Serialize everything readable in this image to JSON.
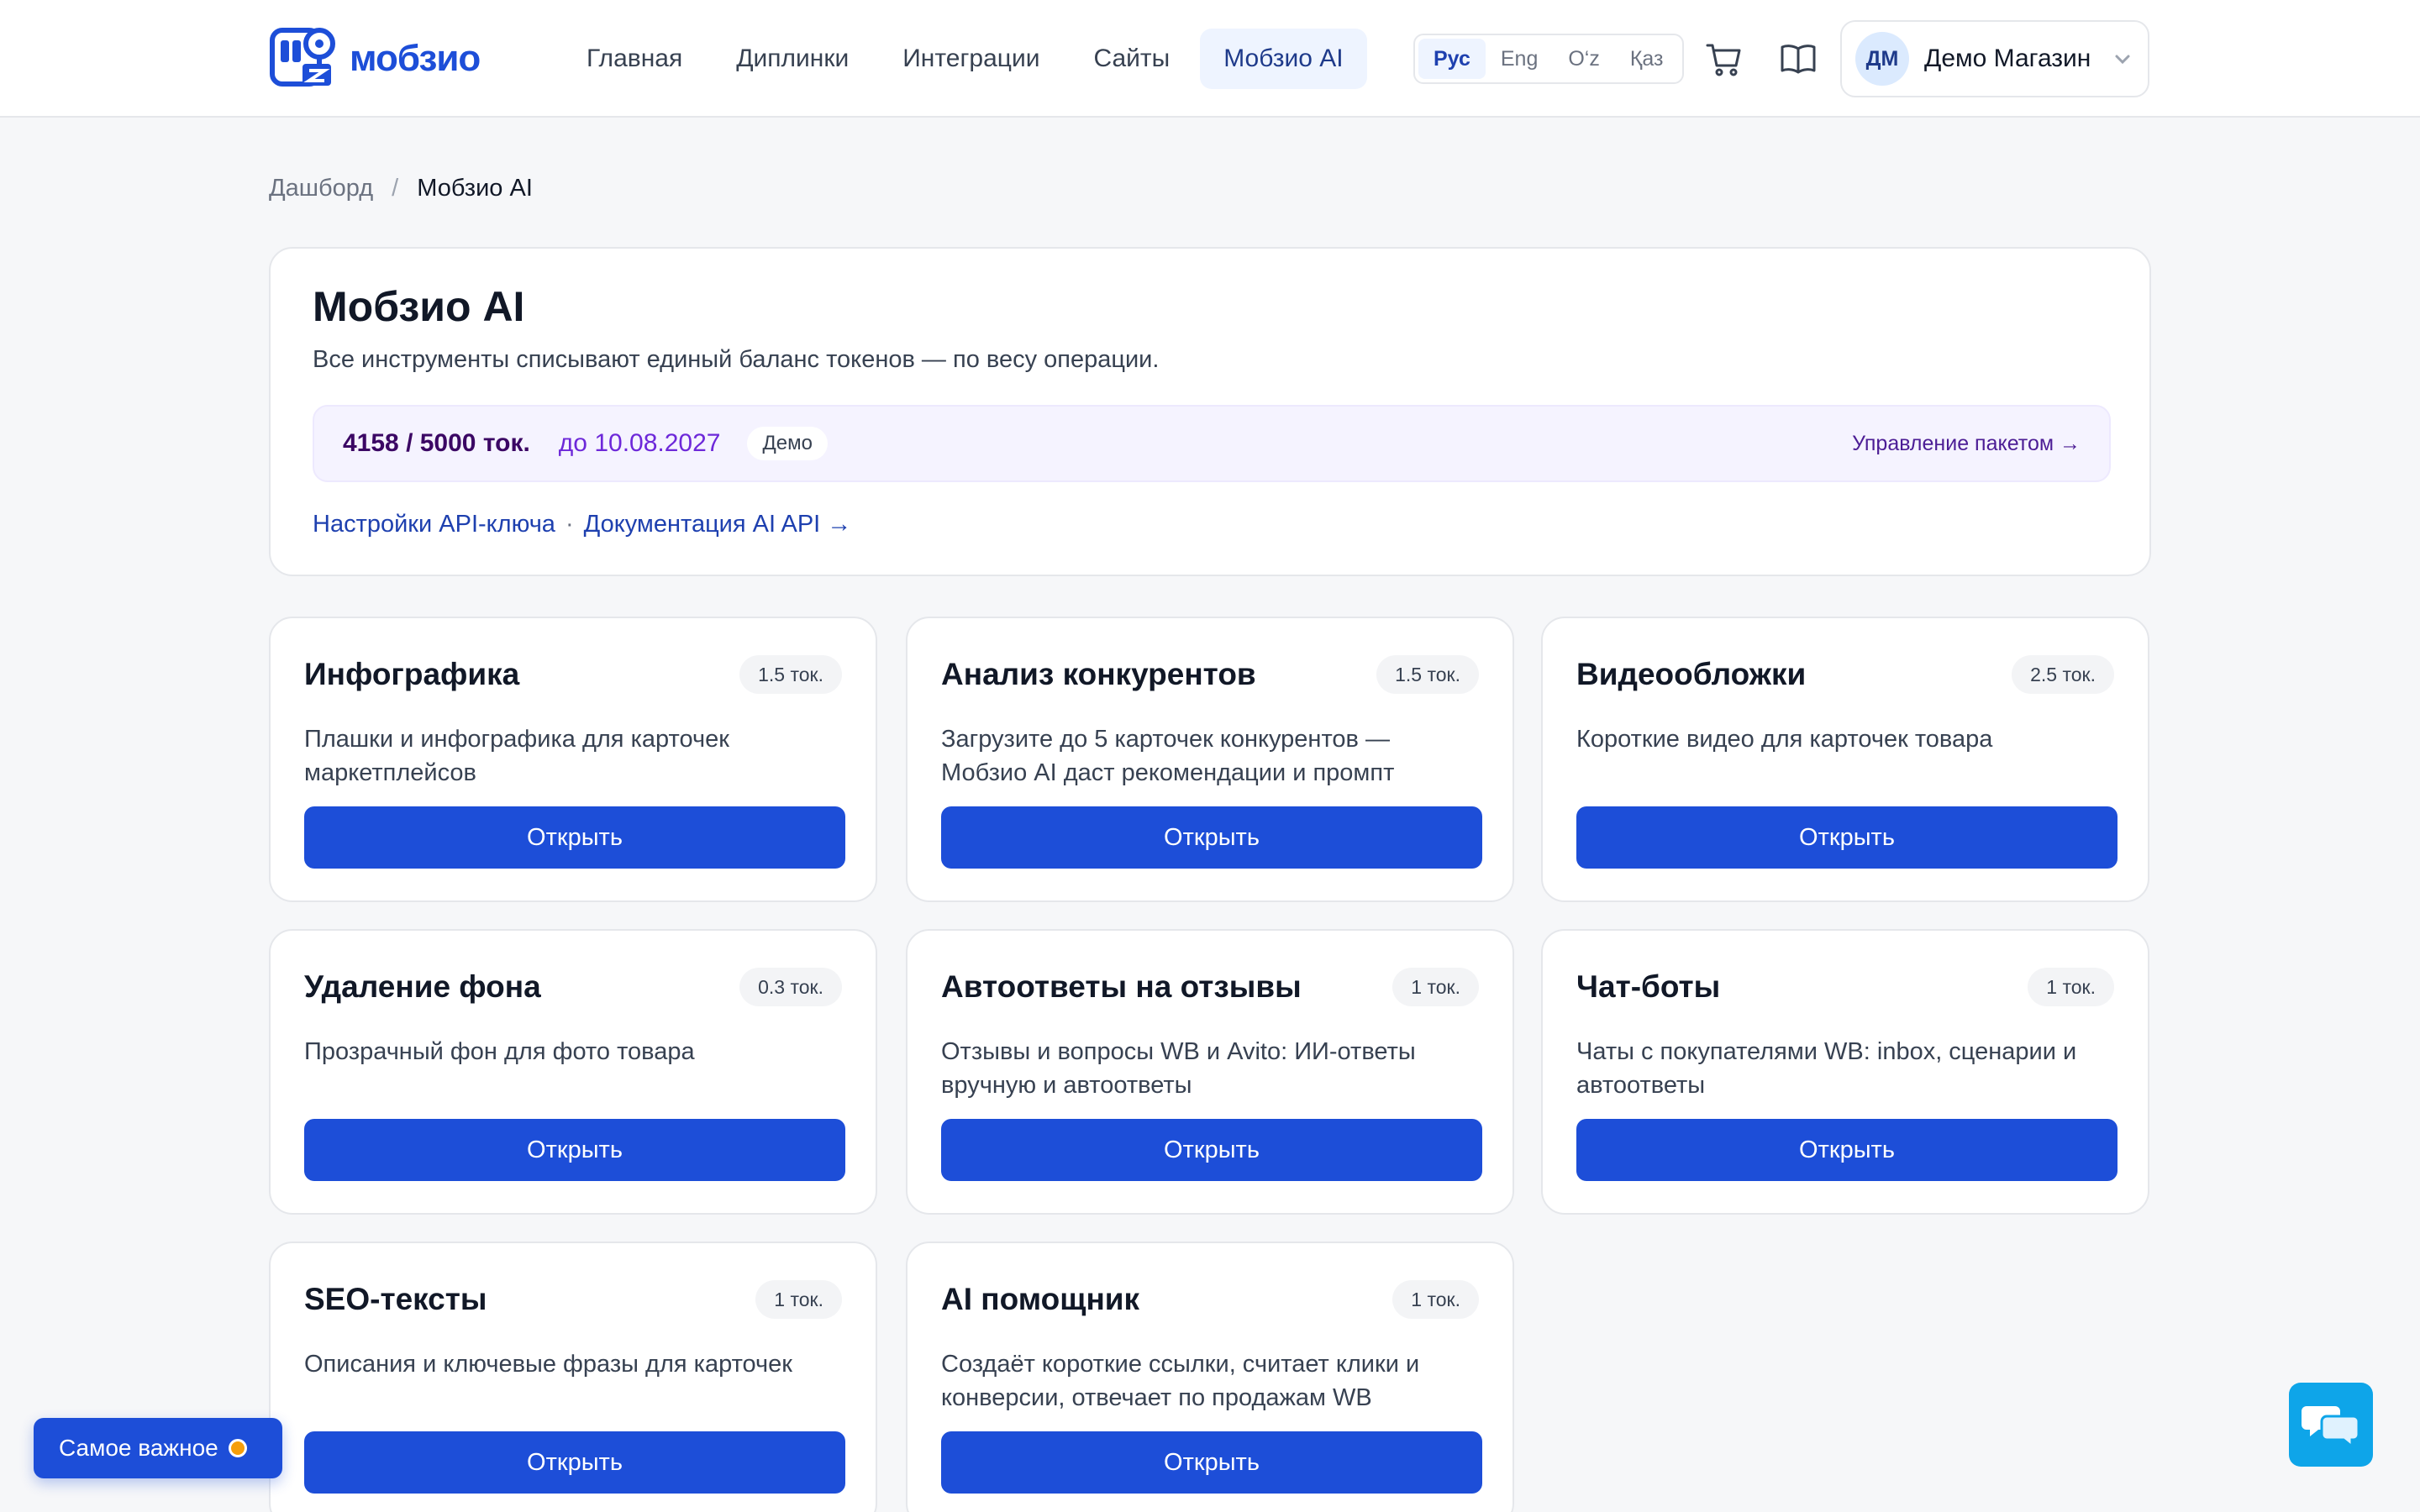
{
  "header": {
    "logo_text": "мобзио",
    "nav": [
      {
        "label": "Главная",
        "active": false
      },
      {
        "label": "Диплинки",
        "active": false
      },
      {
        "label": "Интеграции",
        "active": false
      },
      {
        "label": "Сайты",
        "active": false
      },
      {
        "label": "Мобзио AI",
        "active": true
      }
    ],
    "languages": [
      {
        "label": "Рус",
        "active": true
      },
      {
        "label": "Eng",
        "active": false
      },
      {
        "label": "O‘z",
        "active": false
      },
      {
        "label": "Қаз",
        "active": false
      }
    ],
    "icons": [
      "cart-icon",
      "book-icon"
    ],
    "account": {
      "initials": "ДМ",
      "name": "Демо Магазин"
    }
  },
  "breadcrumb": {
    "parent": "Дашборд",
    "separator": "/",
    "current": "Мобзио AI"
  },
  "hero": {
    "title": "Мобзио AI",
    "subtitle": "Все инструменты списывают единый баланс токенов — по весу операции.",
    "tokens": "4158 / 5000 ток.",
    "tokens_used_fraction": 0.8316,
    "valid_until": "до 10.08.2027",
    "badge": "Демо",
    "manage_link": "Управление пакетом →",
    "api_settings_link": "Настройки API-ключа",
    "links_separator": "·",
    "api_docs_link": "Документация AI API →"
  },
  "tools": [
    {
      "title": "Инфографика",
      "cost": "1.5 ток.",
      "desc": "Плашки и инфографика для карточек маркетплейсов",
      "button": "Открыть"
    },
    {
      "title": "Анализ конкурентов",
      "cost": "1.5 ток.",
      "desc": "Загрузите до 5 карточек конкурентов — Мобзио AI даст рекомендации и промпт",
      "button": "Открыть"
    },
    {
      "title": "Видеообложки",
      "cost": "2.5 ток.",
      "desc": "Короткие видео для карточек товара",
      "button": "Открыть"
    },
    {
      "title": "Удаление фона",
      "cost": "0.3 ток.",
      "desc": "Прозрачный фон для фото товара",
      "button": "Открыть"
    },
    {
      "title": "Автоответы на отзывы",
      "cost": "1 ток.",
      "desc": "Отзывы и вопросы WB и Avito: ИИ-ответы вручную и автоответы",
      "button": "Открыть"
    },
    {
      "title": "Чат-боты",
      "cost": "1 ток.",
      "desc": "Чаты с покупателями WB: inbox, сценарии и автоответы",
      "button": "Открыть"
    },
    {
      "title": "SEO-тексты",
      "cost": "1 ток.",
      "desc": "Описания и ключевые фразы для карточек",
      "button": "Открыть"
    },
    {
      "title": "AI помощник",
      "cost": "1 ток.",
      "desc": "Создаёт короткие ссылки, считает клики и конверсии, отвечает по продажам WB",
      "button": "Открыть"
    }
  ],
  "floating": {
    "important_label": "Самое важное"
  },
  "colors": {
    "primary": "#1d4ed8",
    "token_bg": "#f5f3ff",
    "chat": "#0ea5e9",
    "dot": "#f59e0b"
  }
}
